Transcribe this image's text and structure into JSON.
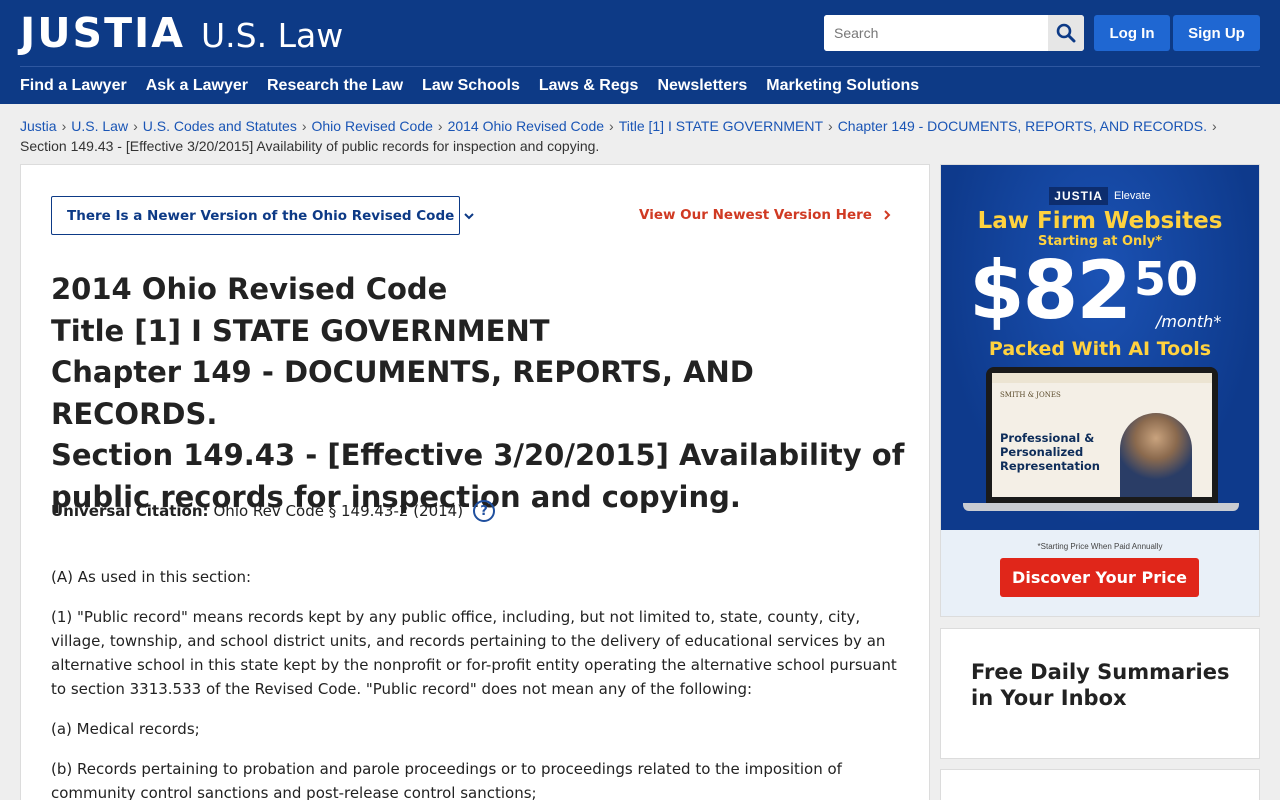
{
  "header": {
    "logo_main": "JUSTIA",
    "logo_sub": "U.S. Law",
    "search_placeholder": "Search",
    "login_label": "Log In",
    "signup_label": "Sign Up",
    "nav": [
      "Find a Lawyer",
      "Ask a Lawyer",
      "Research the Law",
      "Law Schools",
      "Laws & Regs",
      "Newsletters",
      "Marketing Solutions"
    ]
  },
  "breadcrumb": {
    "links": [
      "Justia",
      "U.S. Law",
      "U.S. Codes and Statutes",
      "Ohio Revised Code",
      "2014 Ohio Revised Code",
      "Title [1] I STATE GOVERNMENT",
      "Chapter 149 - DOCUMENTS, REPORTS, AND RECORDS."
    ],
    "separator": "›",
    "current": "Section 149.43 - [Effective 3/20/2015] Availability of public records for inspection and copying."
  },
  "main": {
    "version_dropdown_label": "There Is a Newer Version of the Ohio Revised Code",
    "newest_link_label": "View Our Newest Version Here",
    "title_lines": [
      "2014 Ohio Revised Code",
      "Title [1] I STATE GOVERNMENT",
      "Chapter 149 - DOCUMENTS, REPORTS, AND RECORDS.",
      "Section 149.43 - [Effective 3/20/2015] Availability of public records for inspection and copying."
    ],
    "citation_label": "Universal Citation:",
    "citation_value": "Ohio Rev Code § 149.43-2 (2014)",
    "citation_help": "?",
    "paragraphs": [
      "(A) As used in this section:",
      "(1) \"Public record\" means records kept by any public office, including, but not limited to, state, county, city, village, township, and school district units, and records pertaining to the delivery of educational services by an alternative school in this state kept by the nonprofit or for-profit entity operating the alternative school pursuant to section 3313.533 of the Revised Code. \"Public record\" does not mean any of the following:",
      "(a) Medical records;",
      "(b) Records pertaining to probation and parole proceedings or to proceedings related to the imposition of community control sanctions and post-release control sanctions;"
    ]
  },
  "ad": {
    "brand_logo": "JUSTIA",
    "brand_tag": "Elevate",
    "headline": "Law Firm Websites",
    "subheadline": "Starting at Only*",
    "price_main": "$82",
    "price_cents": "50",
    "price_per": "/month*",
    "tagline": "Packed With AI Tools",
    "laptop_firm": "SMITH & JONES",
    "laptop_text": "Professional & Personalized Representation",
    "fine_print": "*Starting Price When Paid Annually",
    "cta": "Discover Your Price",
    "colors": {
      "background": "#0e3a8c",
      "headline": "#ffd23f",
      "cta": "#e0261a"
    }
  },
  "sidebar": {
    "newsletter_title": "Free Daily Summaries in Your Inbox"
  },
  "colors": {
    "header_bg": "#0d3a86",
    "link": "#1a55b5",
    "accent_red": "#d03a23",
    "button_blue": "#1f67d2"
  }
}
